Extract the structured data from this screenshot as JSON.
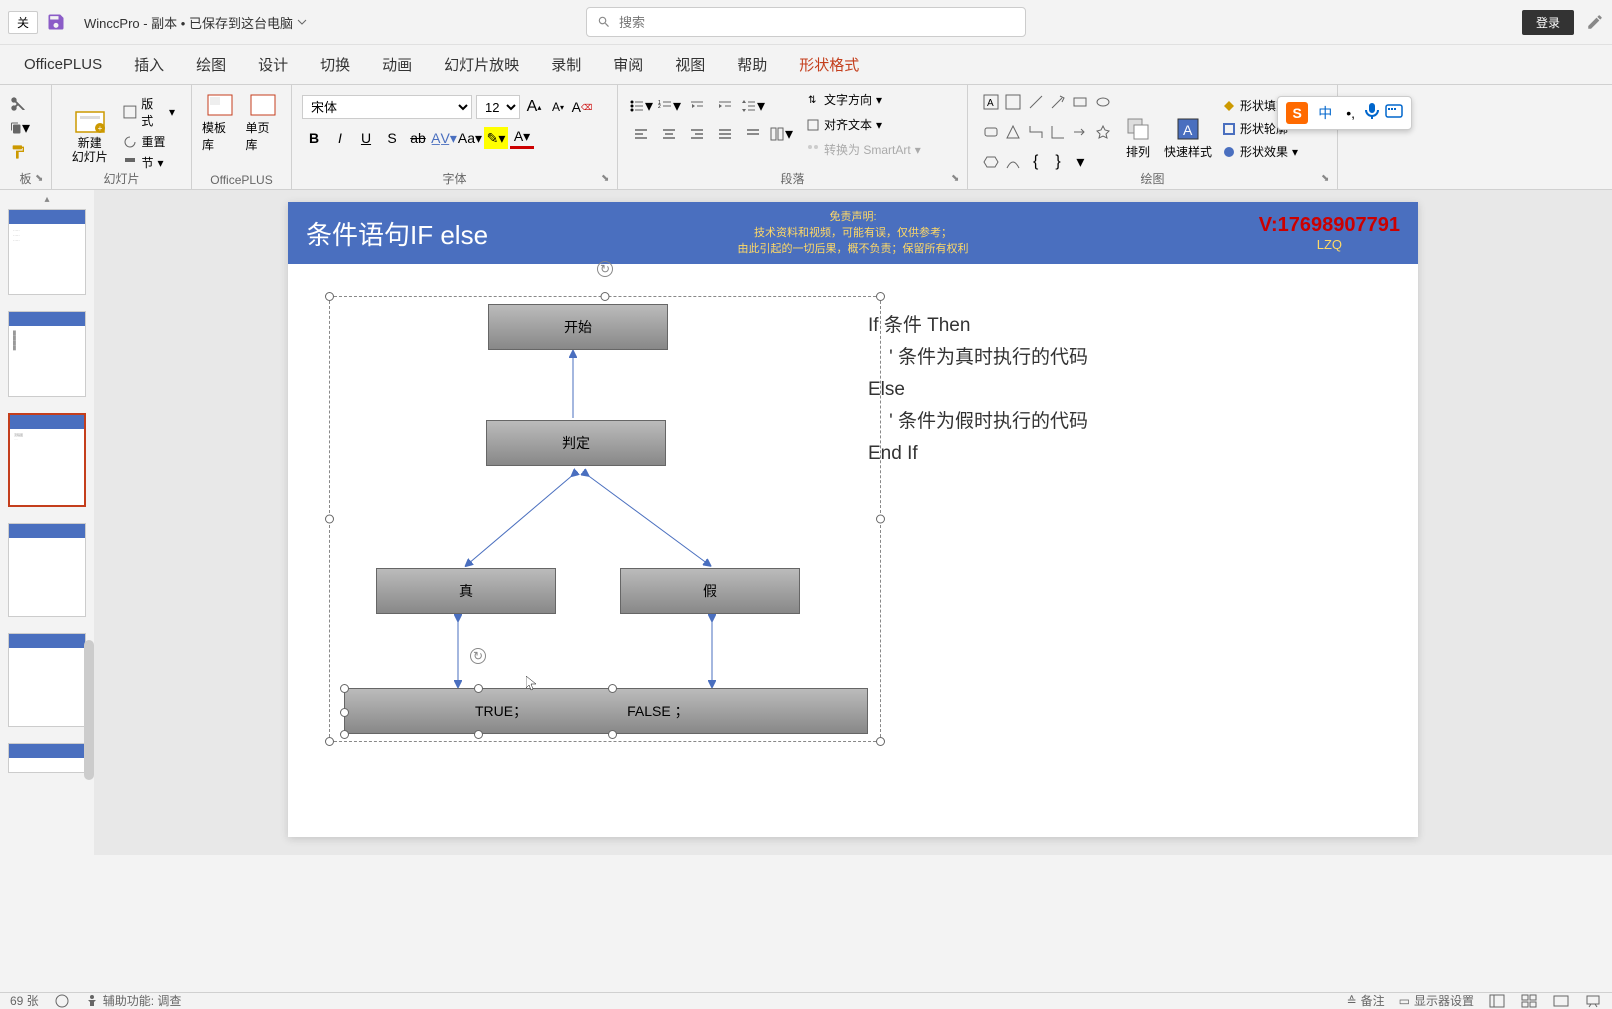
{
  "title_bar": {
    "close": "关",
    "doc_title": "WinccPro - 副本 • 已保存到这台电脑",
    "search_placeholder": "搜索",
    "login": "登录"
  },
  "tabs": {
    "officeplus": "OfficePLUS",
    "insert": "插入",
    "draw": "绘图",
    "design": "设计",
    "transition": "切换",
    "animation": "动画",
    "slideshow": "幻灯片放映",
    "record": "录制",
    "review": "审阅",
    "view": "视图",
    "help": "帮助",
    "shape_format": "形状格式"
  },
  "ribbon": {
    "clipboard_label": "板",
    "slide": {
      "new_slide": "新建\n幻灯片",
      "layout": "版式",
      "reset": "重置",
      "section": "节",
      "label": "幻灯片"
    },
    "officeplus": {
      "template": "模板库",
      "single": "单页库",
      "label": "OfficePLUS"
    },
    "font": {
      "name": "宋体",
      "size": "12",
      "label": "字体"
    },
    "paragraph": {
      "text_dir": "文字方向",
      "align_text": "对齐文本",
      "smartart": "转换为 SmartArt",
      "label": "段落"
    },
    "drawing": {
      "arrange": "排列",
      "quick_style": "快速样式",
      "fill": "形状填充",
      "outline": "形状轮廓",
      "effect": "形状效果",
      "label": "绘图"
    }
  },
  "ime": {
    "logo": "S",
    "lang": "中",
    "punct": "•,"
  },
  "slide": {
    "title": "条件语句IF else",
    "disclaimer_line1": "免责声明:",
    "disclaimer_line2": "技术资料和视频，可能有误，仅供参考；",
    "disclaimer_line3": "由此引起的一切后果，概不负责；保留所有权利",
    "version": "V:17698907791",
    "author": "LZQ",
    "box_start": "开始",
    "box_decide": "判定",
    "box_true": "真",
    "box_false": "假",
    "box_result_true": "TRUE；",
    "box_result_false": "FALSE ；",
    "code_line1": "If 条件 Then",
    "code_line2": "    ' 条件为真时执行的代码",
    "code_line3": "Else",
    "code_line4": "    ' 条件为假时执行的代码",
    "code_line5": "End If"
  },
  "status": {
    "slide_num": "69 张",
    "accessibility": "辅助功能: 调查",
    "notes": "备注",
    "display": "显示器设置"
  }
}
